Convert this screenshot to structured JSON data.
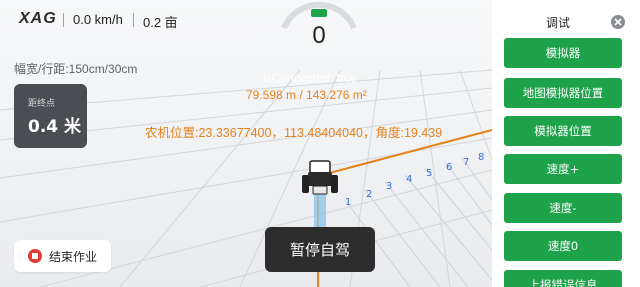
{
  "header": {
    "logo": "XAG",
    "speed": "0.0 km/h",
    "area": "0.2 亩"
  },
  "gauge": {
    "value": "0",
    "accent": "#1fa34a"
  },
  "implement": {
    "width_text": "幅宽/行距:150cm/30cm"
  },
  "distance_card": {
    "label": "距终点",
    "value": "0.4 米"
  },
  "debug": {
    "connection": "isConnected: true",
    "distance": "79.598 m / 143.276 m²",
    "position": "农机位置:23.33677400，113.48404040，角度:19.439"
  },
  "row_numbers": [
    "1",
    "2",
    "3",
    "4",
    "5",
    "6",
    "7",
    "8"
  ],
  "buttons": {
    "end_task": "结束作业",
    "pause_autodrive": "暂停自驾"
  },
  "panel": {
    "title": "调试",
    "items": [
      {
        "label": "模拟器"
      },
      {
        "label": "地图模拟器位置"
      },
      {
        "label": "模拟器位置"
      },
      {
        "label": "速度+"
      },
      {
        "label": "速度-"
      },
      {
        "label": "速度0"
      },
      {
        "label": "上报错误信息"
      }
    ]
  },
  "colors": {
    "button_green": "#1fa34a",
    "path_orange": "#e8811a",
    "row_blue": "#3b6fd8"
  }
}
